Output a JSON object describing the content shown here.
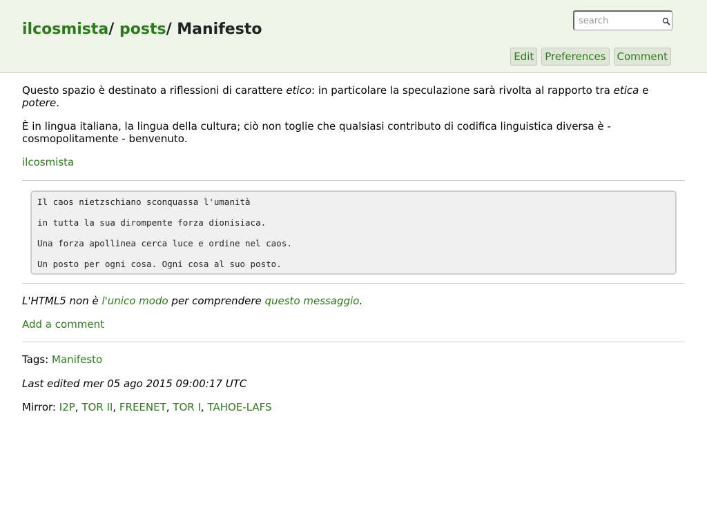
{
  "breadcrumb": {
    "items": [
      "ilcosmista",
      "posts"
    ],
    "separator": "/",
    "current": "Manifesto"
  },
  "search": {
    "placeholder": "search"
  },
  "actions": [
    "Edit",
    "Preferences",
    "Comment"
  ],
  "intro": {
    "p1_before": "Questo spazio è destinato a riflessioni di carattere ",
    "p1_etico": "etico",
    "p1_mid": ": in particolare la speculazione sarà rivolta al rapporto tra ",
    "p1_etica": "etica",
    "p1_and": " e ",
    "p1_potere": "potere",
    "p1_end": ".",
    "p2": "È in lingua italiana, la lingua della cultura; ciò non toglie che qualsiasi contributo di codifica linguistica diversa è - cosmopolitamente - benvenuto."
  },
  "author_link": "ilcosmista",
  "poem": [
    "Il caos nietzschiano sconquassa l'umanità",
    "in tutta la sua dirompente forza dionisiaca.",
    "Una forza apollinea cerca luce e ordine nel caos.",
    "Un posto per ogni cosa. Ogni cosa al suo posto."
  ],
  "html5_note": {
    "before": "L'HTML5 non è ",
    "link1": "l'unico modo",
    "mid": " per comprendere ",
    "link2": "questo messaggio",
    "end": "."
  },
  "add_comment": "Add a comment",
  "tags": {
    "label": "Tags:",
    "items": [
      "Manifesto"
    ]
  },
  "last_edited": "Last edited mer 05 ago 2015 09:00:17 UTC",
  "mirror": {
    "label": "Mirror:",
    "items": [
      "I2P",
      "TOR II",
      "FREENET",
      "TOR I",
      "TAHOE-LAFS"
    ]
  },
  "colors": {
    "link": "#2d7a1c",
    "header_bg": "#eef4e8",
    "button_bg": "#dfe6d8"
  }
}
